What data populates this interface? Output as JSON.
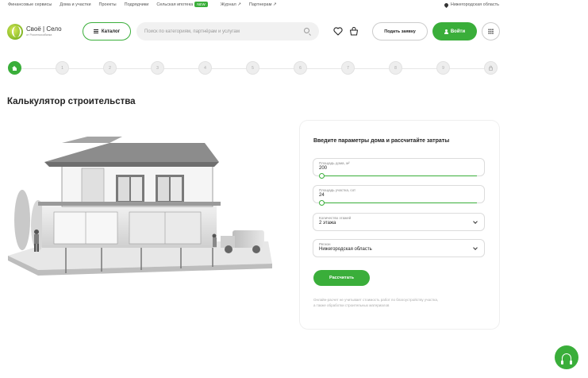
{
  "topnav": {
    "links": [
      "Финансовые сервисы",
      "Дома и участки",
      "Проекты",
      "Подрядчики",
      "Сельская ипотека",
      "Журнал ↗",
      "Партнерам ↗"
    ],
    "new_badge": "NEW",
    "region": "Нижегородская область"
  },
  "header": {
    "logo_title": "Своё | Село",
    "logo_subtitle": "от Россельхозбанка",
    "catalog_label": "Каталог",
    "search_placeholder": "Поиск по категориям, партнёрам и услугам",
    "request_label": "Подать заявку",
    "login_label": "Войти",
    "icons": [
      "heart-icon",
      "cart-icon",
      "search-icon",
      "grid-icon",
      "user-icon"
    ]
  },
  "stepper": {
    "steps": [
      "home",
      "1",
      "2",
      "3",
      "4",
      "5",
      "6",
      "7",
      "8",
      "9",
      "lock"
    ],
    "active_index": 0
  },
  "page": {
    "title": "Калькулятор строительства"
  },
  "calculator": {
    "heading": "Введите параметры дома и рассчитайте затраты",
    "fields": [
      {
        "label": "Площадь дома, м²",
        "value": "200"
      },
      {
        "label": "Площадь участка, сот",
        "value": "24"
      },
      {
        "label": "Количество этажей",
        "value": "2 этажа"
      },
      {
        "label": "Регион",
        "value": "Нижегородская область"
      }
    ],
    "submit_label": "Рассчитать",
    "note": "Онлайн-расчет не учитывает стоимость работ по благоустройству участка, а также обработки строительных материалов"
  },
  "colors": {
    "accent": "#3aae3a",
    "text": "#222222",
    "muted": "#999999"
  }
}
